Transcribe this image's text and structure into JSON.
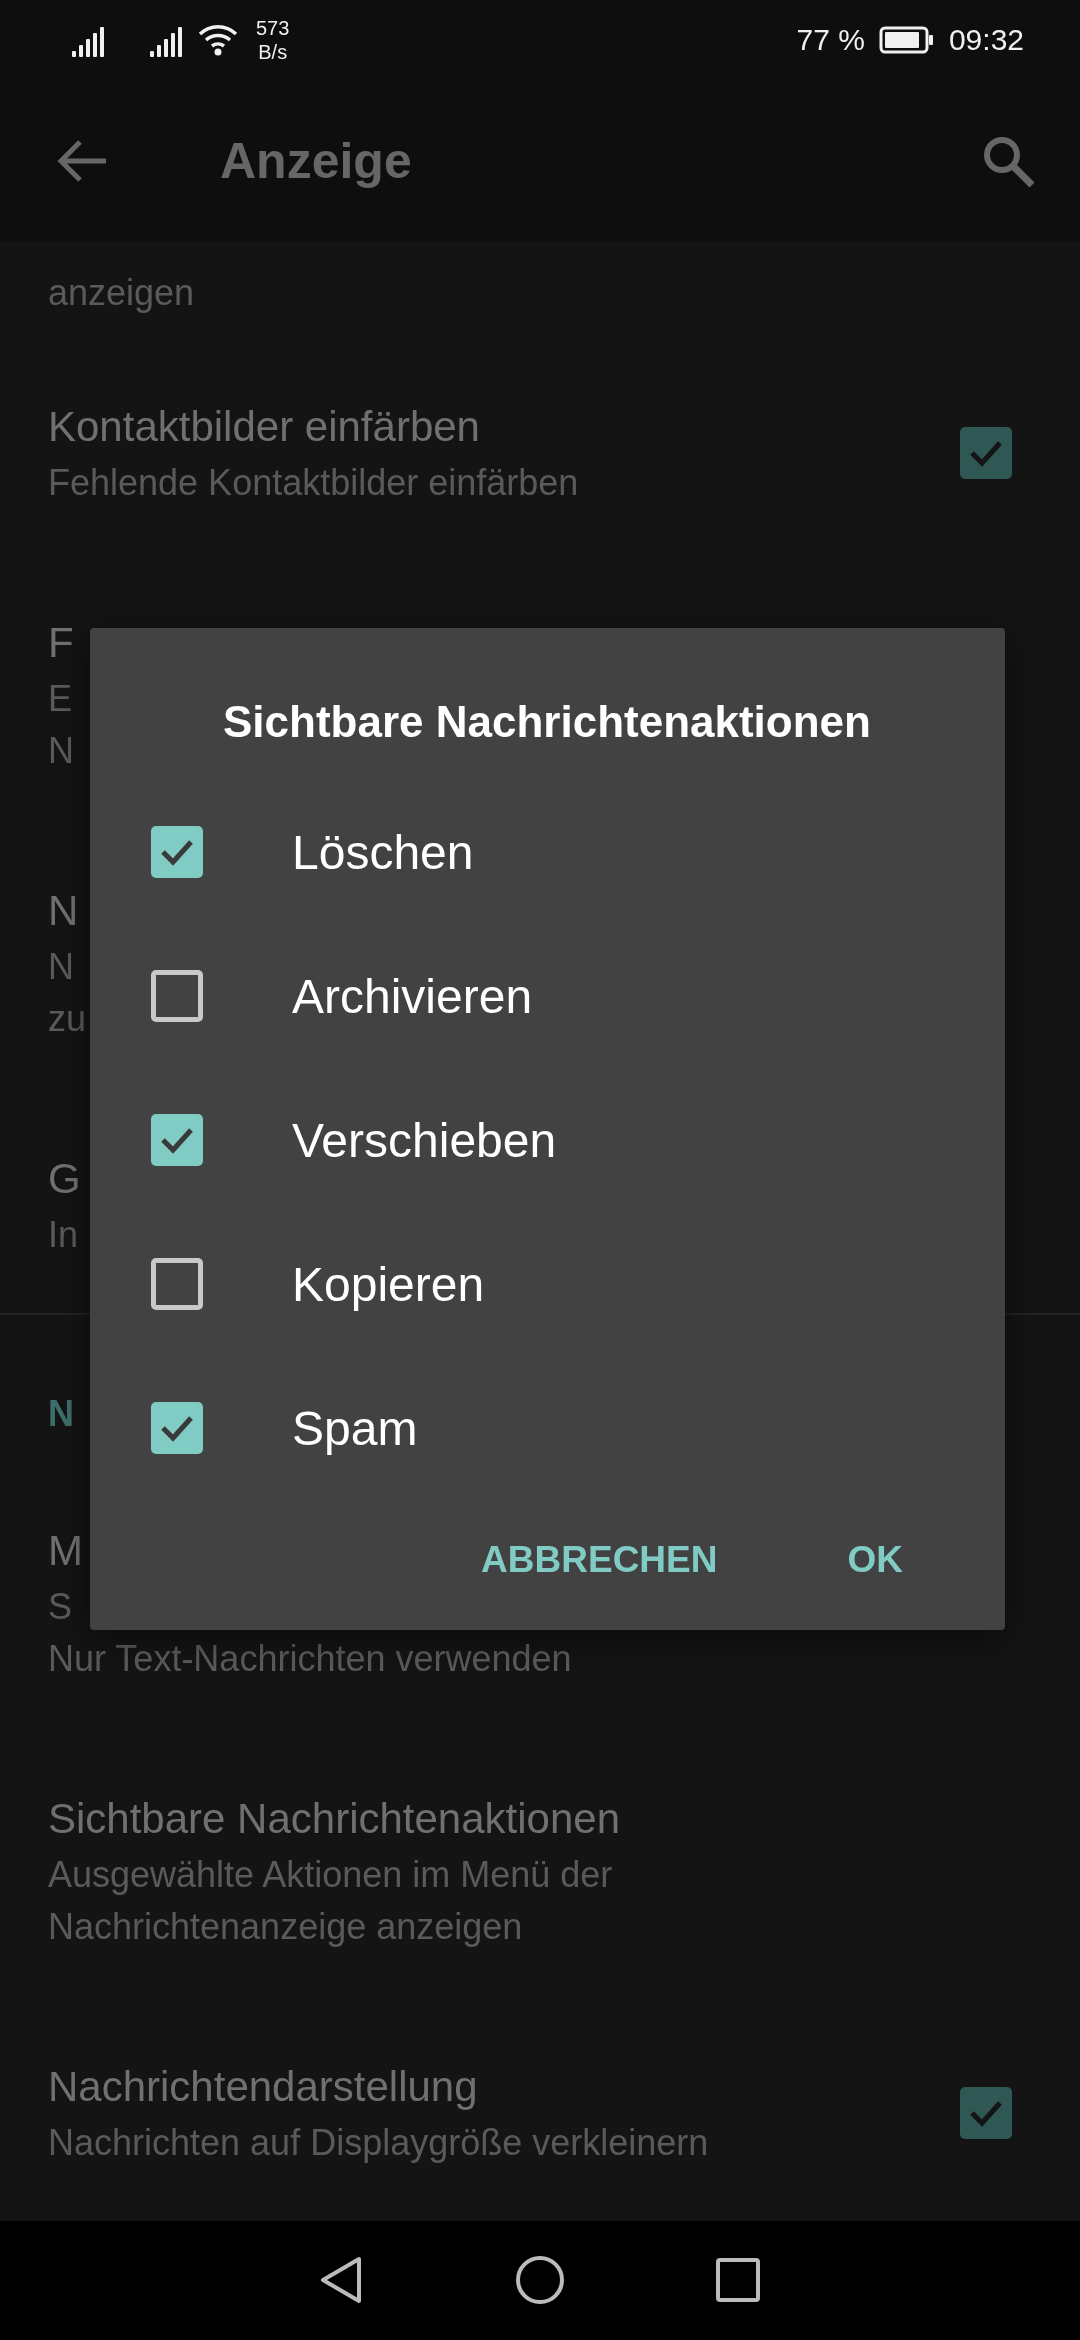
{
  "status_bar": {
    "net_speed": [
      "573",
      "B/s"
    ],
    "battery": "77 %",
    "time": "09:32"
  },
  "toolbar": {
    "title": "Anzeige"
  },
  "settings": [
    {
      "kind": "row",
      "summary": [
        "anzeigen"
      ]
    },
    {
      "kind": "row",
      "title": "Kontaktbilder einfärben",
      "summary": [
        "Fehlende Kontaktbilder einfärben"
      ],
      "checked": true
    },
    {
      "kind": "row",
      "title": "F",
      "summary": [
        "E",
        "N"
      ]
    },
    {
      "kind": "row",
      "title": "N",
      "summary": [
        "N",
        "zu"
      ]
    },
    {
      "kind": "row",
      "title": "G",
      "summary": [
        "In"
      ]
    },
    {
      "kind": "divider"
    },
    {
      "kind": "header",
      "title": "N"
    },
    {
      "kind": "row",
      "title": "M",
      "summary": [
        "S",
        "Nur Text-Nachrichten verwenden"
      ]
    },
    {
      "kind": "row",
      "title": "Sichtbare Nachrichtenaktionen",
      "summary": [
        "Ausgewählte Aktionen im Menü der",
        "Nachrichtenanzeige anzeigen"
      ]
    },
    {
      "kind": "row",
      "title": "Nachrichtendarstellung",
      "summary": [
        "Nachrichten auf Displaygröße verkleinern"
      ],
      "checked": true
    }
  ],
  "dialog": {
    "title": "Sichtbare Nachrichtenaktionen",
    "options": [
      {
        "label": "Löschen",
        "checked": true
      },
      {
        "label": "Archivieren",
        "checked": false
      },
      {
        "label": "Verschieben",
        "checked": true
      },
      {
        "label": "Kopieren",
        "checked": false
      },
      {
        "label": "Spam",
        "checked": true
      }
    ],
    "buttons": [
      "ABBRECHEN",
      "OK"
    ]
  }
}
